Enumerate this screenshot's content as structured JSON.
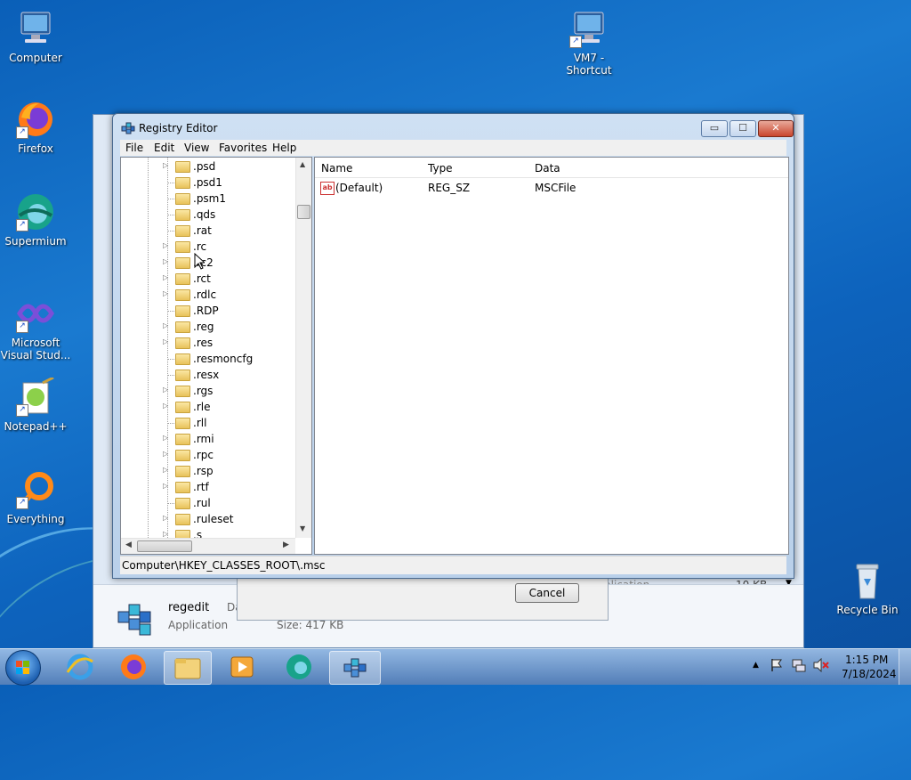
{
  "desktop": {
    "icons": [
      {
        "label": "Computer",
        "icon": "computer-icon"
      },
      {
        "label": "Firefox",
        "icon": "firefox-icon"
      },
      {
        "label": "Supermium",
        "icon": "supermium-icon"
      },
      {
        "label": "Microsoft Visual Stud...",
        "icon": "visual-studio-icon"
      },
      {
        "label": "Notepad++",
        "icon": "notepadpp-icon"
      },
      {
        "label": "Everything",
        "icon": "everything-icon"
      },
      {
        "label": "VM7 - Shortcut",
        "icon": "vm-shortcut-icon"
      },
      {
        "label": "Recycle Bin",
        "icon": "recycle-bin-icon"
      }
    ]
  },
  "background_window": {
    "details_name": "regedit",
    "details_type": "Application",
    "details_date_label": "Da",
    "details_size": "Size: 417 KB",
    "list_type_partial": "plication",
    "list_size": "10 KB",
    "dialog_cancel": "Cancel"
  },
  "regedit": {
    "title": "Registry Editor",
    "menu": [
      "File",
      "Edit",
      "View",
      "Favorites",
      "Help"
    ],
    "tree_items": [
      ".psd",
      ".psd1",
      ".psm1",
      ".qds",
      ".rat",
      ".rc",
      ".rc2",
      ".rct",
      ".rdlc",
      ".RDP",
      ".reg",
      ".res",
      ".resmoncfg",
      ".resx",
      ".rgs",
      ".rle",
      ".rll",
      ".rmi",
      ".rpc",
      ".rsp",
      ".rtf",
      ".rul",
      ".ruleset",
      ".s"
    ],
    "columns": [
      "Name",
      "Type",
      "Data"
    ],
    "values": [
      {
        "name": "(Default)",
        "type": "REG_SZ",
        "data": "MSCFile"
      }
    ],
    "status_path": "Computer\\HKEY_CLASSES_ROOT\\.msc",
    "caption_buttons": {
      "minimize": "▭",
      "maximize": "☐",
      "close": "✕"
    }
  },
  "taskbar": {
    "time": "1:15 PM",
    "date": "7/18/2024",
    "tray_expander": "▲"
  }
}
